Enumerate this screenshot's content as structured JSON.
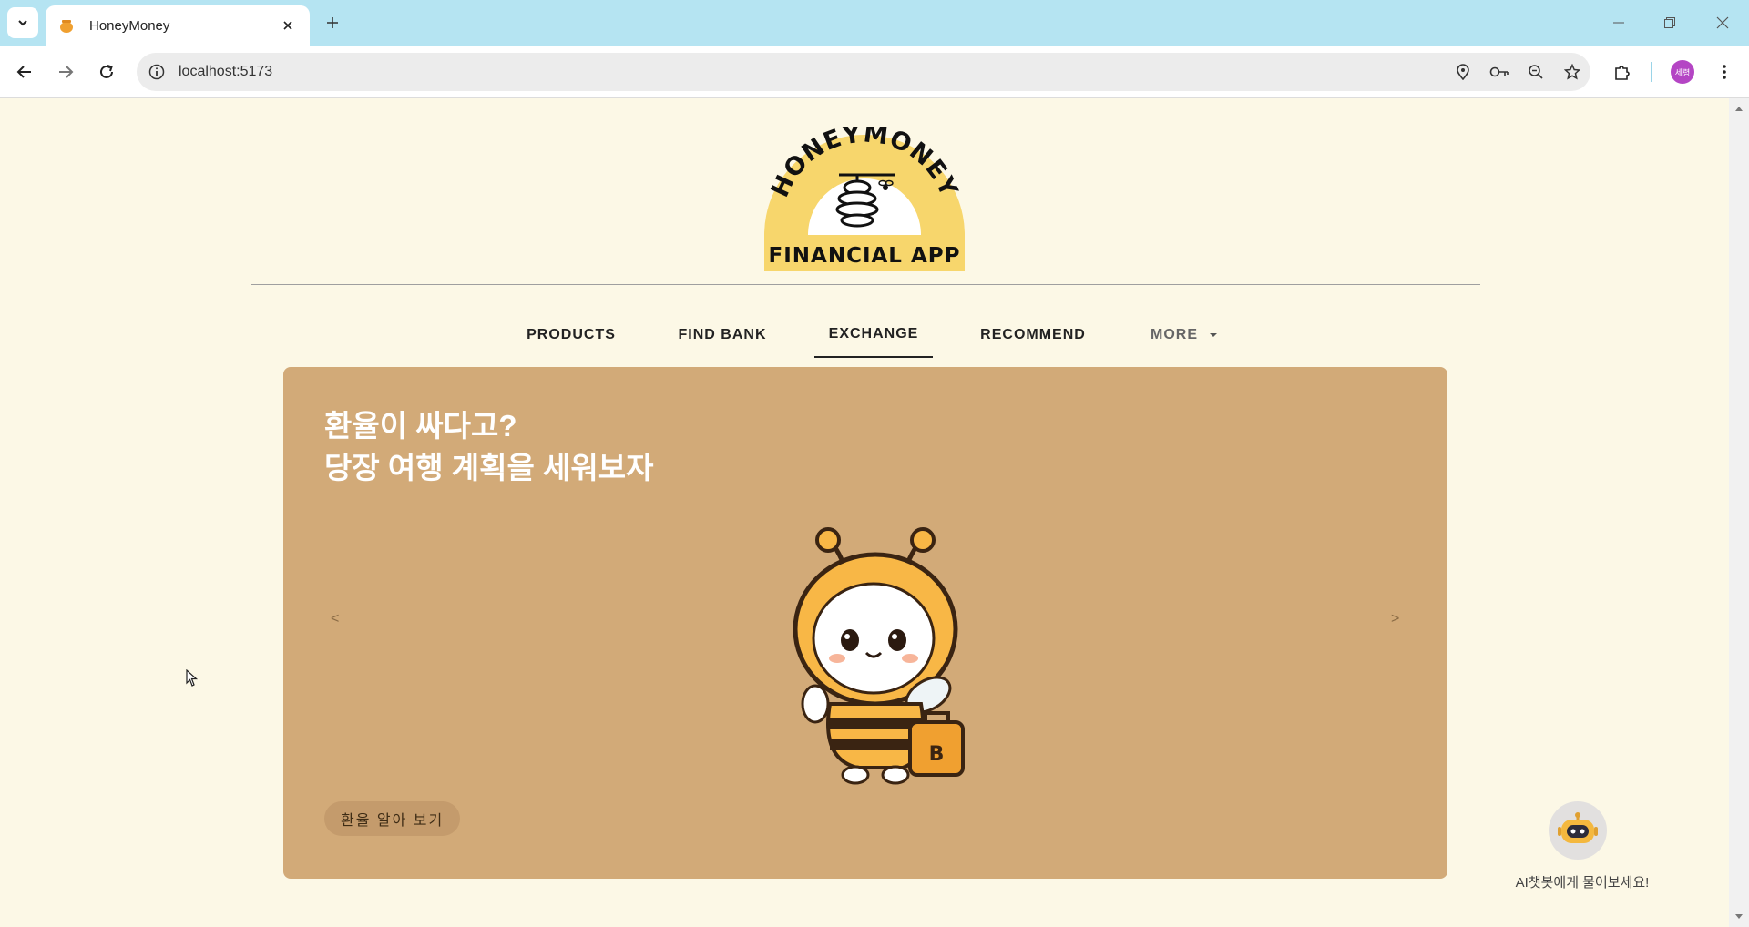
{
  "browser": {
    "tab_title": "HoneyMoney",
    "url": "localhost:5173",
    "profile_label": "세령"
  },
  "logo": {
    "arc_text": "HONEYMONEY",
    "subtitle": "FINANCIAL APP"
  },
  "nav": {
    "items": [
      {
        "label": "PRODUCTS"
      },
      {
        "label": "FIND BANK"
      },
      {
        "label": "EXCHANGE"
      },
      {
        "label": "RECOMMEND"
      },
      {
        "label": "MORE"
      }
    ],
    "active": "EXCHANGE"
  },
  "hero": {
    "line1": "환율이 싸다고?",
    "line2": "당장 여행 계획을 세워보자",
    "prev": "<",
    "next": ">",
    "cta_label": "환율 알아 보기",
    "bag_letter": "B"
  },
  "chatbot": {
    "label": "AI챗봇에게 물어보세요!"
  },
  "colors": {
    "tabbar": "#b5e4f2",
    "page_bg": "#fcf8e6",
    "hero_bg": "#d2aa78",
    "cta_bg": "#c49b6c",
    "honey": "#f7d66c"
  }
}
